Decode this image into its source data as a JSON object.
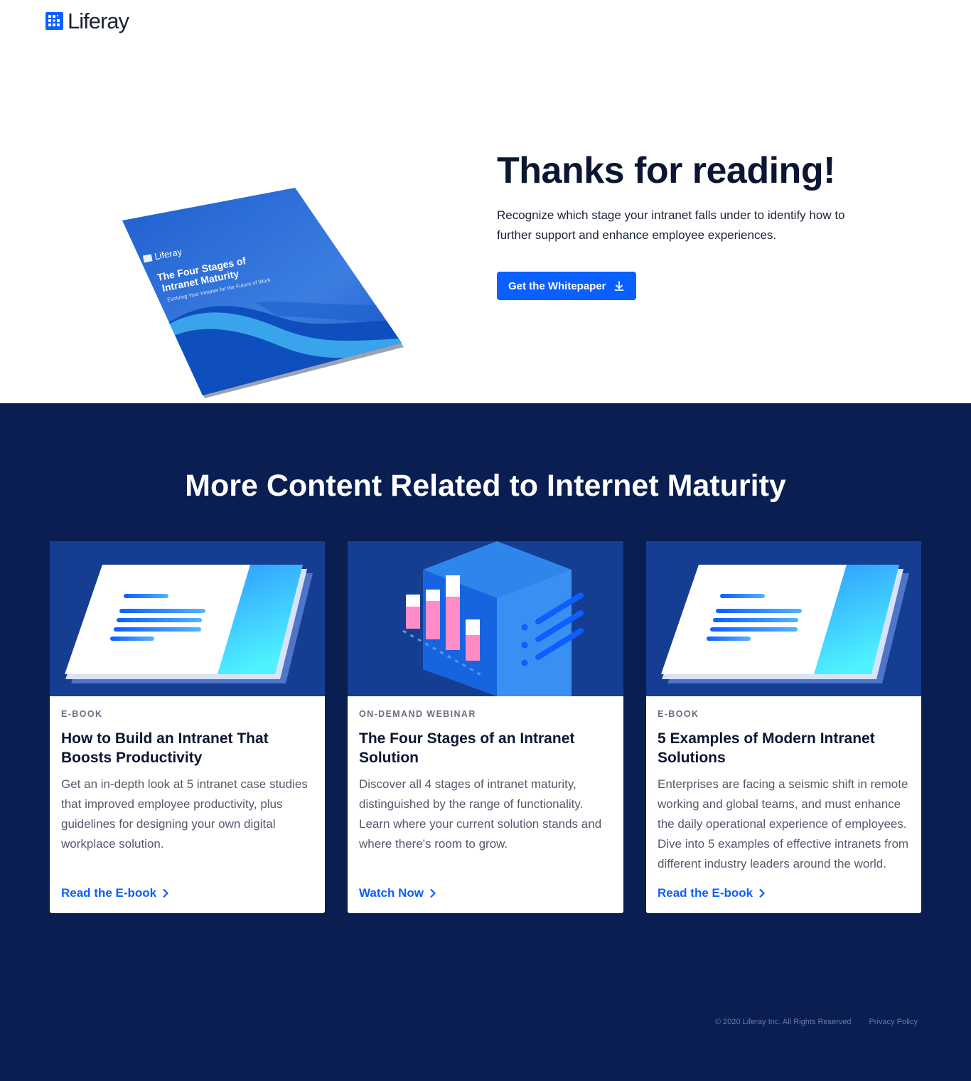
{
  "header": {
    "logo_text": "Liferay",
    "logo_icon": "liferay-logo-icon"
  },
  "hero": {
    "title": "Thanks for reading!",
    "description": "Recognize which stage your intranet falls under to identify how to further support and enhance employee experiences.",
    "cta_label": "Get the Whitepaper",
    "cta_icon": "download-icon",
    "booklet": {
      "brand": "Liferay",
      "title_line1": "The Four Stages of",
      "title_line2": "Intranet Maturity",
      "subtitle": "Evolving Your Intranet for the Future of Work"
    }
  },
  "related": {
    "title": "More Content Related to Internet Maturity",
    "cards": [
      {
        "eyebrow": "E-BOOK",
        "title": "How to Build an Intranet That Boosts Productivity",
        "description": "Get an in-depth look at 5 intranet case studies that improved employee productivity, plus guidelines for designing your own digital workplace solution.",
        "link_label": "Read the E-book",
        "art": "ebook-illustration"
      },
      {
        "eyebrow": "ON-DEMAND WEBINAR",
        "title": "The Four Stages of an Intranet Solution",
        "description": "Discover all 4 stages of intranet maturity, distinguished by the range of functionality. Learn where your current solution stands and where there's room to grow.",
        "link_label": "Watch Now",
        "art": "webinar-cube-illustration"
      },
      {
        "eyebrow": "E-BOOK",
        "title": "5 Examples of Modern Intranet Solutions",
        "description": "Enterprises are facing a seismic shift in remote working and global teams, and must enhance the daily operational experience of employees. Dive into 5 examples of effective intranets from different industry leaders around the world.",
        "link_label": "Read the E-book",
        "art": "ebook-illustration"
      }
    ]
  },
  "footer": {
    "copyright": "© 2020 Liferay Inc. All Rights Reserved",
    "privacy": "Privacy Policy"
  },
  "colors": {
    "brand_blue": "#0b5fff",
    "dark_navy": "#0a1e52",
    "card_art_bg": "#153d91"
  }
}
